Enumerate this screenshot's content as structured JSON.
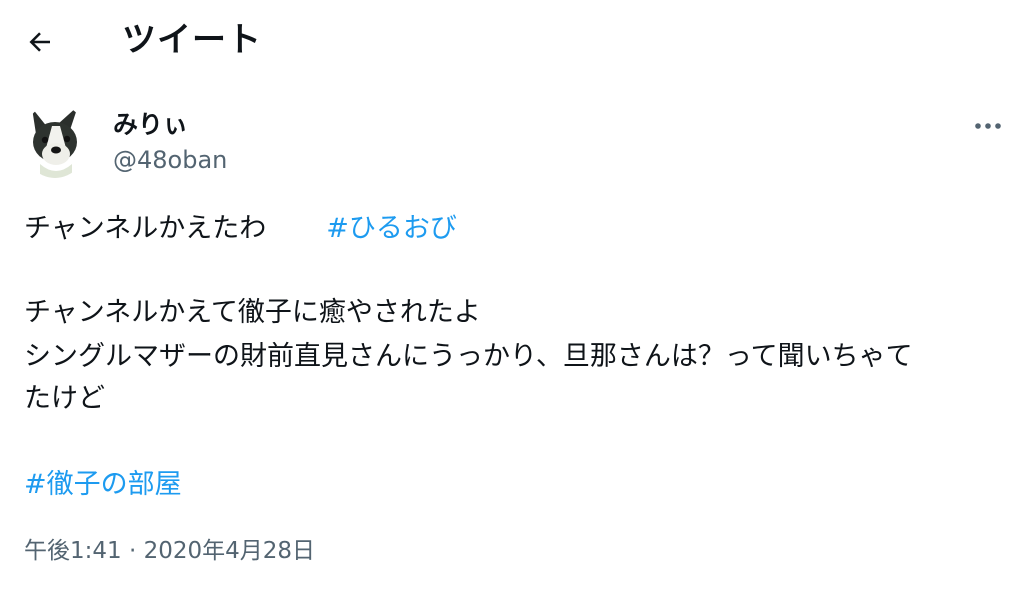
{
  "header": {
    "title": "ツイート",
    "back_icon": "arrow-left-icon"
  },
  "author": {
    "display_name": "みりぃ",
    "handle": "@48oban",
    "avatar_icon": "boston-terrier-avatar"
  },
  "menu": {
    "icon": "more-horizontal-icon"
  },
  "tweet": {
    "line1_text": "チャンネルかえたわ",
    "line1_hashtag": "#ひるおび",
    "line2": "チャンネルかえて徹子に癒やされたよ",
    "line3": "シングルマザーの財前直見さんにうっかり、旦那さんは？って聞いちゃて",
    "line4": "たけど",
    "hashtag2": "#徹子の部屋"
  },
  "timestamp": "午後1:41 · 2020年4月28日",
  "colors": {
    "link": "#1d9bf0",
    "secondary_text": "#536471",
    "primary_text": "#0f1419"
  }
}
